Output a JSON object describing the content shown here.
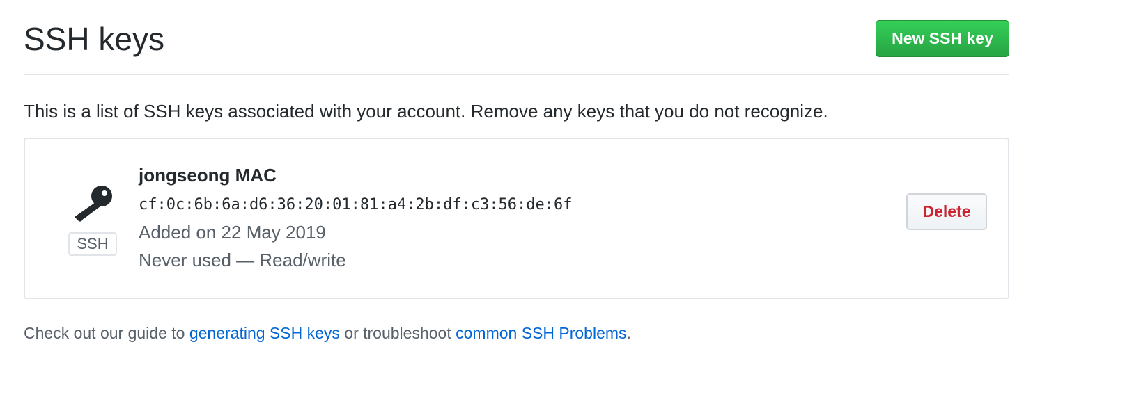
{
  "header": {
    "title": "SSH keys",
    "new_key_label": "New SSH key"
  },
  "intro": {
    "text": "This is a list of SSH keys associated with your account. Remove any keys that you do not recognize."
  },
  "keys": [
    {
      "icon": "key-icon",
      "type_badge": "SSH",
      "title": "jongseong MAC",
      "fingerprint": "cf:0c:6b:6a:d6:36:20:01:81:a4:2b:df:c3:56:de:6f",
      "added": "Added on 22 May 2019",
      "usage": "Never used — Read/write",
      "delete_label": "Delete"
    }
  ],
  "footer": {
    "prefix": "Check out our guide to ",
    "link1_text": "generating SSH keys",
    "middle": " or troubleshoot ",
    "link2_text": "common SSH Problems",
    "suffix": "."
  },
  "colors": {
    "primary_button": "#28a745",
    "danger_text": "#cb2431",
    "link": "#0366d6",
    "muted_text": "#586069",
    "border": "#e1e4e8"
  }
}
